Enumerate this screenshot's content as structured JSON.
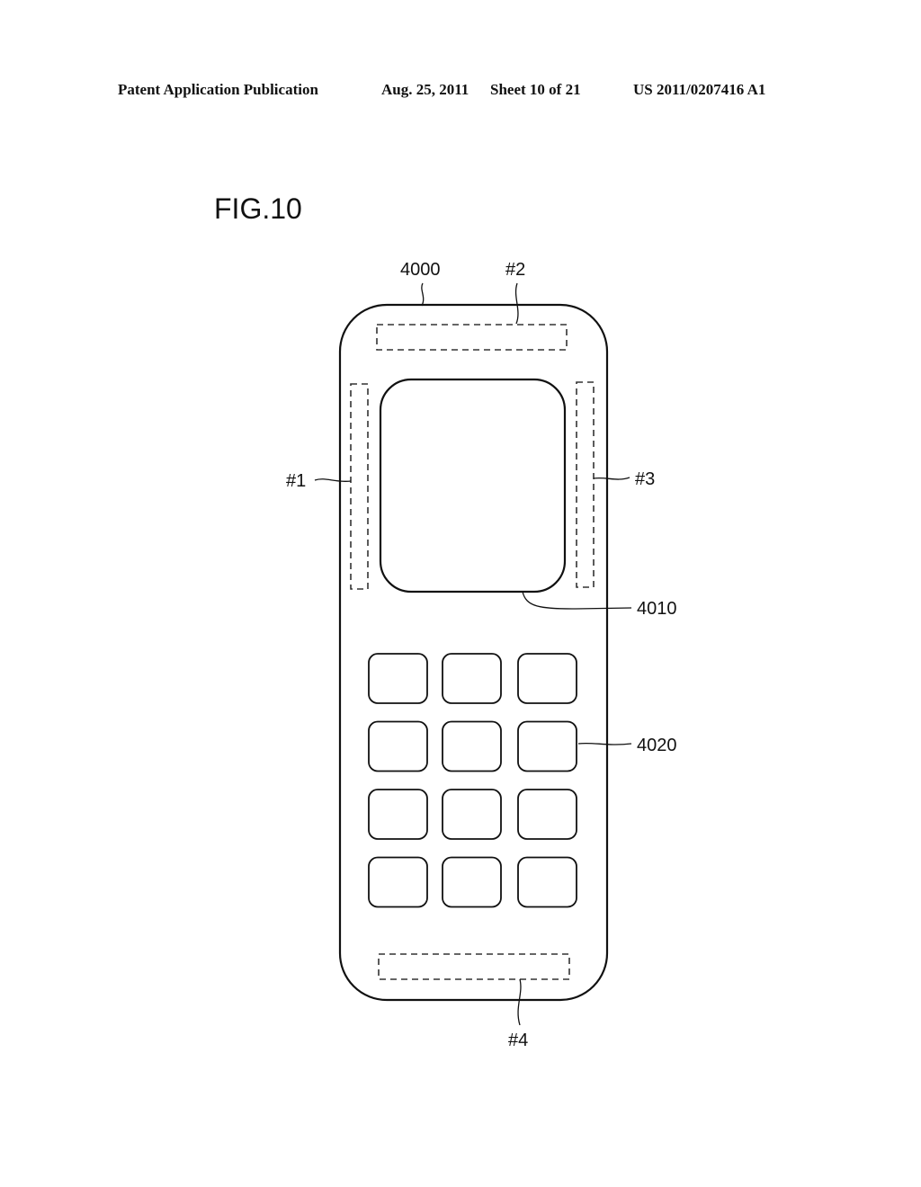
{
  "header": {
    "publication": "Patent Application Publication",
    "date": "Aug. 25, 2011",
    "sheet": "Sheet 10 of 21",
    "number": "US 2011/0207416 A1"
  },
  "figure": {
    "title": "FIG.10",
    "labels": {
      "body": "4000",
      "display": "4010",
      "keys": "4020",
      "antenna_1": "#1",
      "antenna_2": "#2",
      "antenna_3": "#3",
      "antenna_4": "#4"
    },
    "keypad": {
      "rows": 4,
      "cols": 3
    }
  }
}
